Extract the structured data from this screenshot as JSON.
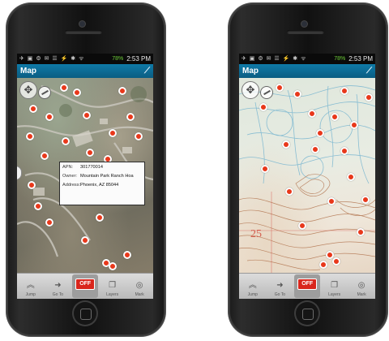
{
  "status_bar": {
    "time": "2:53 PM",
    "battery": "78%"
  },
  "app": {
    "title": "Map"
  },
  "left_phone": {
    "popup": {
      "apn_label": "APN:",
      "apn_value": "301770014",
      "owner_label": "Owner:",
      "owner_value": "Mountain Park Ranch Hoa",
      "address_label": "Address:",
      "address_value": "Phoenix, AZ 85044"
    },
    "basemap": "satellite"
  },
  "right_phone": {
    "section_number": "25",
    "basemap": "topographic"
  },
  "toolbar": {
    "jump_label": "Jump",
    "goto_label": "Go To",
    "off_label": "OFF",
    "layers_label": "Layers",
    "mark_label": "Mark"
  },
  "colors": {
    "title_bar": "#0a6d96",
    "marker": "#e8381b",
    "off_button": "#d9261c"
  },
  "icons": {
    "jump": "double-chevron-up-icon",
    "goto": "arrow-right-icon",
    "layers": "layers-icon",
    "mark": "target-icon",
    "gps": "gps-signal-icon",
    "navigation": "pan-control-icon",
    "compass": "compass-icon"
  }
}
